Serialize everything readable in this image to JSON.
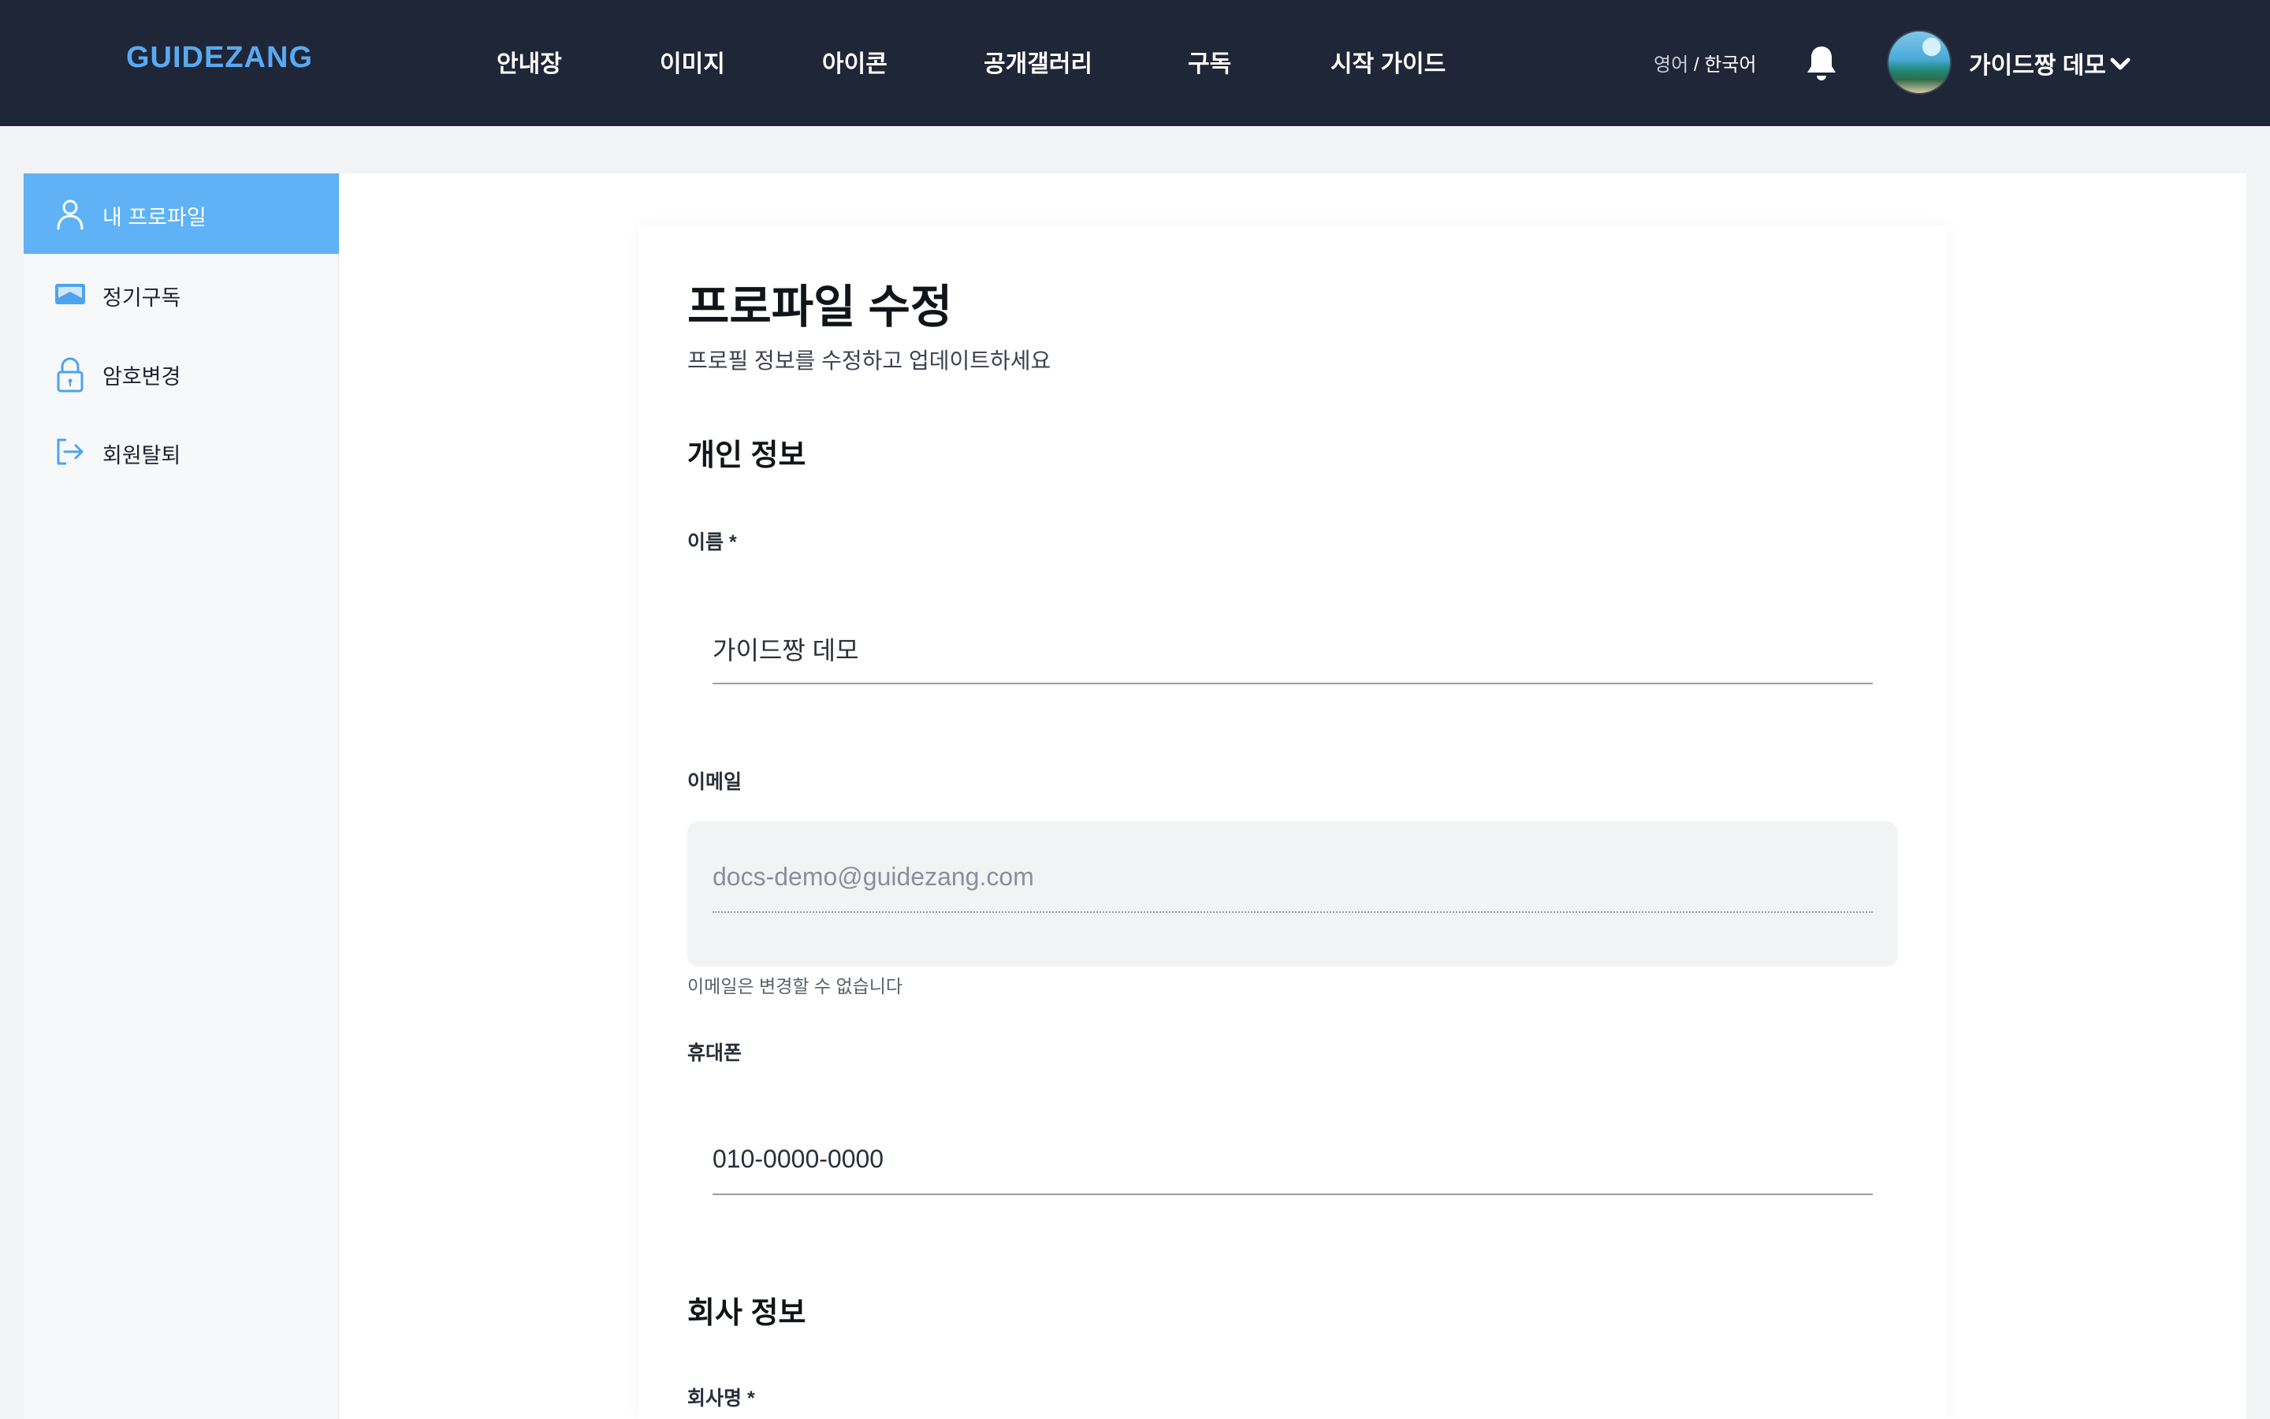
{
  "header": {
    "logo": "GUIDEZANG",
    "nav": [
      "안내장",
      "이미지",
      "아이콘",
      "공개갤러리",
      "구독",
      "시작 가이드"
    ],
    "lang_inactive": "영어",
    "lang_separator": " / ",
    "lang_active": "한국어",
    "user_name": "가이드짱 데모",
    "icons": {
      "notification": "bell-icon",
      "menu": "chevron-down-icon"
    }
  },
  "sidebar": {
    "items": [
      {
        "label": "내 프로파일",
        "icon": "user-icon",
        "active": true
      },
      {
        "label": "정기구독",
        "icon": "subscription-card-icon",
        "active": false
      },
      {
        "label": "암호변경",
        "icon": "lock-icon",
        "active": false
      },
      {
        "label": "회원탈퇴",
        "icon": "logout-icon",
        "active": false
      }
    ]
  },
  "main": {
    "title": "프로파일 수정",
    "subtitle": "프로필 정보를 수정하고 업데이트하세요",
    "personal_section": "개인 정보",
    "name_label": "이름 *",
    "name_value": "가이드짱 데모",
    "email_label": "이메일",
    "email_value": "docs-demo@guidezang.com",
    "email_helper": "이메일은 변경할 수 없습니다",
    "phone_label": "휴대폰",
    "phone_value": "010-0000-0000",
    "company_section": "회사 정보",
    "company_label": "회사명 *"
  },
  "colors": {
    "header_bg": "#1e2637",
    "logo": "#5aaaf2",
    "sidebar_active": "#5eb2f5",
    "icon_blue": "#4ea3ee"
  }
}
